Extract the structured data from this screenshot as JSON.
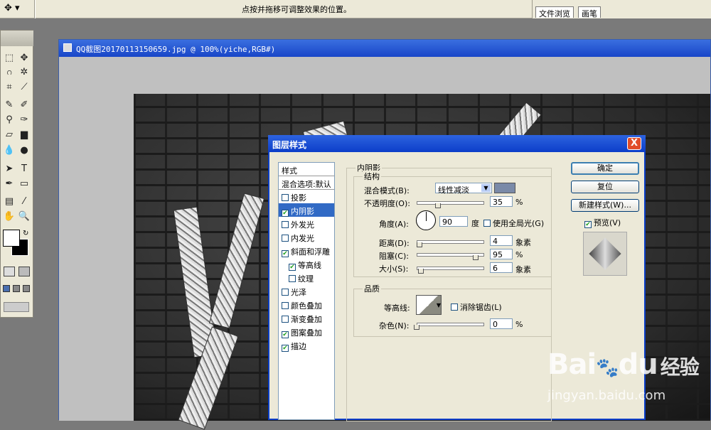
{
  "options_bar": {
    "hint": "点按并拖移可调整效果的位置。"
  },
  "palette_well": {
    "tabs": [
      "文件浏览",
      "画笔"
    ]
  },
  "document": {
    "title": "QQ截图20170113150659.jpg @ 100%(yiche,RGB#)"
  },
  "dialog": {
    "title": "图层样式",
    "close": "X",
    "styles": [
      {
        "label": "样式",
        "checkbox": false,
        "checked": false,
        "selected": false
      },
      {
        "label": "混合选项:默认",
        "checkbox": false,
        "checked": false,
        "selected": false
      },
      {
        "label": "投影",
        "checkbox": true,
        "checked": false,
        "selected": false
      },
      {
        "label": "内阴影",
        "checkbox": true,
        "checked": true,
        "selected": true
      },
      {
        "label": "外发光",
        "checkbox": true,
        "checked": false,
        "selected": false
      },
      {
        "label": "内发光",
        "checkbox": true,
        "checked": false,
        "selected": false
      },
      {
        "label": "斜面和浮雕",
        "checkbox": true,
        "checked": true,
        "selected": false
      },
      {
        "label": "等高线",
        "checkbox": true,
        "checked": true,
        "selected": false
      },
      {
        "label": "纹理",
        "checkbox": true,
        "checked": false,
        "selected": false
      },
      {
        "label": "光泽",
        "checkbox": true,
        "checked": false,
        "selected": false
      },
      {
        "label": "颜色叠加",
        "checkbox": true,
        "checked": false,
        "selected": false
      },
      {
        "label": "渐变叠加",
        "checkbox": true,
        "checked": false,
        "selected": false
      },
      {
        "label": "图案叠加",
        "checkbox": true,
        "checked": true,
        "selected": false
      },
      {
        "label": "描边",
        "checkbox": true,
        "checked": true,
        "selected": false
      }
    ],
    "section_title": "内阴影",
    "structure": {
      "title": "结构",
      "blend_mode_label": "混合模式(B):",
      "blend_mode_value": "线性减淡",
      "blend_color": "#7a8aa8",
      "opacity_label": "不透明度(O):",
      "opacity_value": "35",
      "opacity_unit": "%",
      "opacity_level": 0.35,
      "angle_label": "角度(A):",
      "angle_value": "90",
      "angle_unit": "度",
      "global_light_label": "使用全局光(G)",
      "distance_label": "距离(D):",
      "distance_value": "4",
      "distance_unit": "象素",
      "distance_level": 0.0,
      "choke_label": "阻塞(C):",
      "choke_value": "95",
      "choke_unit": "%",
      "choke_level": 0.95,
      "size_label": "大小(S):",
      "size_value": "6",
      "size_unit": "象素",
      "size_level": 0.02
    },
    "quality": {
      "title": "品质",
      "contour_label": "等高线:",
      "antialias_label": "消除锯齿(L)",
      "noise_label": "杂色(N):",
      "noise_value": "0",
      "noise_unit": "%",
      "noise_level": 0.0
    },
    "buttons": {
      "ok": "确定",
      "reset": "复位",
      "new_style": "新建样式(W)...",
      "preview": "预览(V)"
    }
  },
  "watermark": {
    "brand": "Bai",
    "brand2": "du",
    "cn": "经验",
    "url": "jingyan.baidu.com"
  }
}
